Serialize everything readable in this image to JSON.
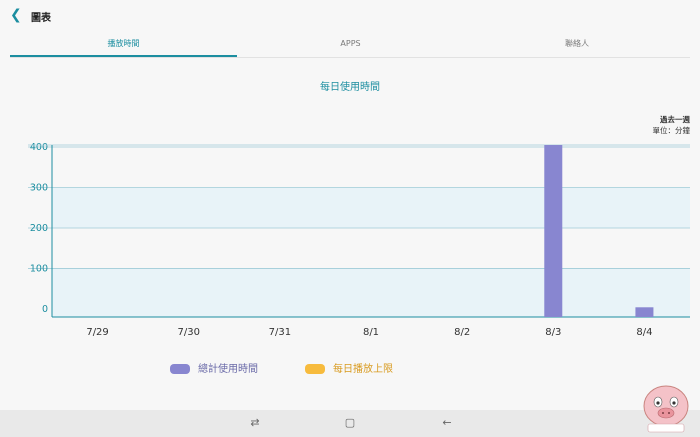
{
  "header": {
    "title": "圖表"
  },
  "tabs": [
    {
      "label": "播放時間",
      "active": true
    },
    {
      "label": "APPS",
      "active": false
    },
    {
      "label": "聯絡人",
      "active": false
    }
  ],
  "chart_title": "每日使用時間",
  "period": "過去一週",
  "unit": "單位：分鐘",
  "chart_data": {
    "type": "bar",
    "categories": [
      "7/29",
      "7/30",
      "7/31",
      "8/1",
      "8/2",
      "8/3",
      "8/4"
    ],
    "series": [
      {
        "name": "總計使用時間",
        "values": [
          0,
          0,
          0,
          0,
          0,
          405,
          4
        ],
        "color": "#8886d0"
      }
    ],
    "yticks": [
      0,
      100,
      200,
      300,
      400
    ],
    "ylim": [
      -20,
      405
    ],
    "grid": true,
    "legend_position": "bottom"
  },
  "legend": [
    {
      "label": "總計使用時間",
      "color": "#8886d0",
      "text_color": "#6a6aa8"
    },
    {
      "label": "每日播放上限",
      "color": "#f7bb3d",
      "text_color": "#d89a1e"
    }
  ],
  "nav": {
    "recent_icon": "recent-apps-icon",
    "home_icon": "home-icon",
    "back_icon": "back-icon"
  }
}
